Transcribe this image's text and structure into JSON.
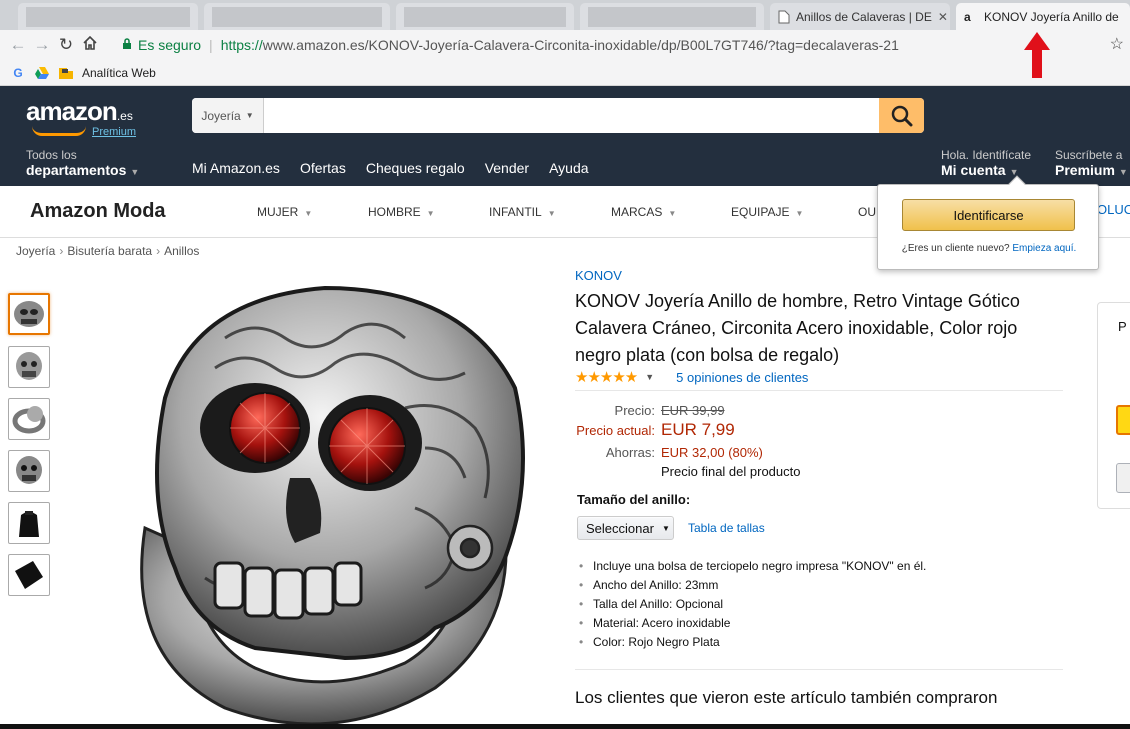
{
  "browser": {
    "tabs": [
      {
        "title": ""
      },
      {
        "title": ""
      },
      {
        "title": ""
      },
      {
        "title": ""
      },
      {
        "title": "Anillos de Calaveras | DE"
      },
      {
        "title": "KONOV Joyería Anillo de",
        "favicon": "a"
      }
    ],
    "address": {
      "secure_label": "Es seguro",
      "url_scheme": "https://",
      "url_rest": "www.amazon.es/KONOV-Joyería-Calavera-Circonita-inoxidable/dp/B00L7GT746/?tag=decalaveras-21"
    },
    "bookmarks": [
      {
        "label": ""
      },
      {
        "label": ""
      },
      {
        "label": "Analítica Web"
      }
    ]
  },
  "header": {
    "logo_text": "amazon",
    "logo_suffix": ".es",
    "logo_sub": "Premium",
    "search_category": "Joyería",
    "search_placeholder": "",
    "departments_line1": "Todos los",
    "departments_line2": "departamentos",
    "nav_links": [
      "Mi Amazon.es",
      "Ofertas",
      "Cheques regalo",
      "Vender",
      "Ayuda"
    ],
    "account_line1": "Hola. Identifícate",
    "account_line2": "Mi cuenta",
    "prime_line1": "Suscríbete a",
    "prime_line2": "Premium"
  },
  "moda": {
    "title": "Amazon Moda",
    "items": [
      "MUJER",
      "HOMBRE",
      "INFANTIL",
      "MARCAS",
      "EQUIPAJE",
      "OU"
    ],
    "trailing": "OLUC"
  },
  "breadcrumb": [
    "Joyería",
    "Bisutería barata",
    "Anillos"
  ],
  "product": {
    "brand": "KONOV",
    "title": "KONOV Joyería Anillo de hombre, Retro Vintage Gótico Calavera Cráneo, Circonita Acero inoxidable, Color rojo negro plata (con bolsa de regalo)",
    "rating": 5,
    "stars": "★★★★★",
    "reviews": "5 opiniones de clientes",
    "price_label": "Precio:",
    "price_old": "EUR 39,99",
    "current_label": "Precio actual:",
    "price_current": "EUR 7,99",
    "savings_label": "Ahorras:",
    "savings": "EUR 32,00 (80%)",
    "final_note": "Precio final del producto",
    "size_label": "Tamaño del anillo:",
    "size_select": "Seleccionar",
    "size_chart": "Tabla de tallas",
    "bullets": [
      "Incluye una bolsa de terciopelo negro impresa \"KONOV\" en él.",
      "Ancho del Anillo: 23mm",
      "Talla del Anillo: Opcional",
      "Material: Acero inoxidable",
      "Color: Rojo Negro Plata"
    ],
    "also_bought": "Los clientes que vieron este artículo también compraron"
  },
  "buybox": {
    "partial": "P"
  },
  "flyout": {
    "signin": "Identificarse",
    "new_customer": "¿Eres un cliente nuevo?",
    "start_here": "Empieza aquí."
  },
  "colors": {
    "header_bg": "#232f3e",
    "accent_orange": "#ff9900",
    "link_blue": "#0066c0",
    "price_red": "#b12704",
    "annotation_red": "#e0101a"
  }
}
